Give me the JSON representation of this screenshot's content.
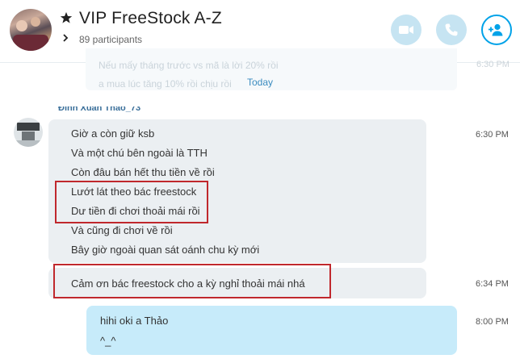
{
  "header": {
    "title": "VIP FreeStock A-Z",
    "participants": "89 participants",
    "icons": {
      "favorite": "star-icon",
      "expand": "chevron-right-icon",
      "video": "video-camera-icon",
      "call": "phone-icon",
      "add": "add-person-icon"
    }
  },
  "faded": {
    "lines": [
      "Nếu mấy tháng trước vs mã là lời 20% rồi",
      "a mua lúc tăng 10% rồi chịu rồi"
    ],
    "time": "6:30 PM"
  },
  "divider": "Today",
  "group": {
    "sender": "Đinh Xuân Thảo_73",
    "messages": [
      "Giờ a còn giữ ksb",
      "Và một chú bên ngoài là TTH",
      "Còn đâu bán hết thu tiền về rồi",
      "Lướt lát theo bác freestock",
      "Dư tiền đi chơi thoải mái rồi",
      "Và cũng đi chơi về rồi",
      "Bây giờ ngoài quan sát oánh chu kỳ mới"
    ],
    "time": "6:30 PM",
    "second_message": "Cảm ơn bác freestock cho a kỳ nghỉ thoải mái nhá",
    "second_time": "6:34 PM"
  },
  "outgoing": {
    "lines": [
      "hihi oki a Thảo",
      "^_^"
    ],
    "time": "8:00 PM"
  },
  "colors": {
    "accent": "#00a2e8",
    "incoming_bubble": "#ebeff2",
    "outgoing_bubble": "#c7ebfa",
    "highlight": "#c0282d"
  }
}
